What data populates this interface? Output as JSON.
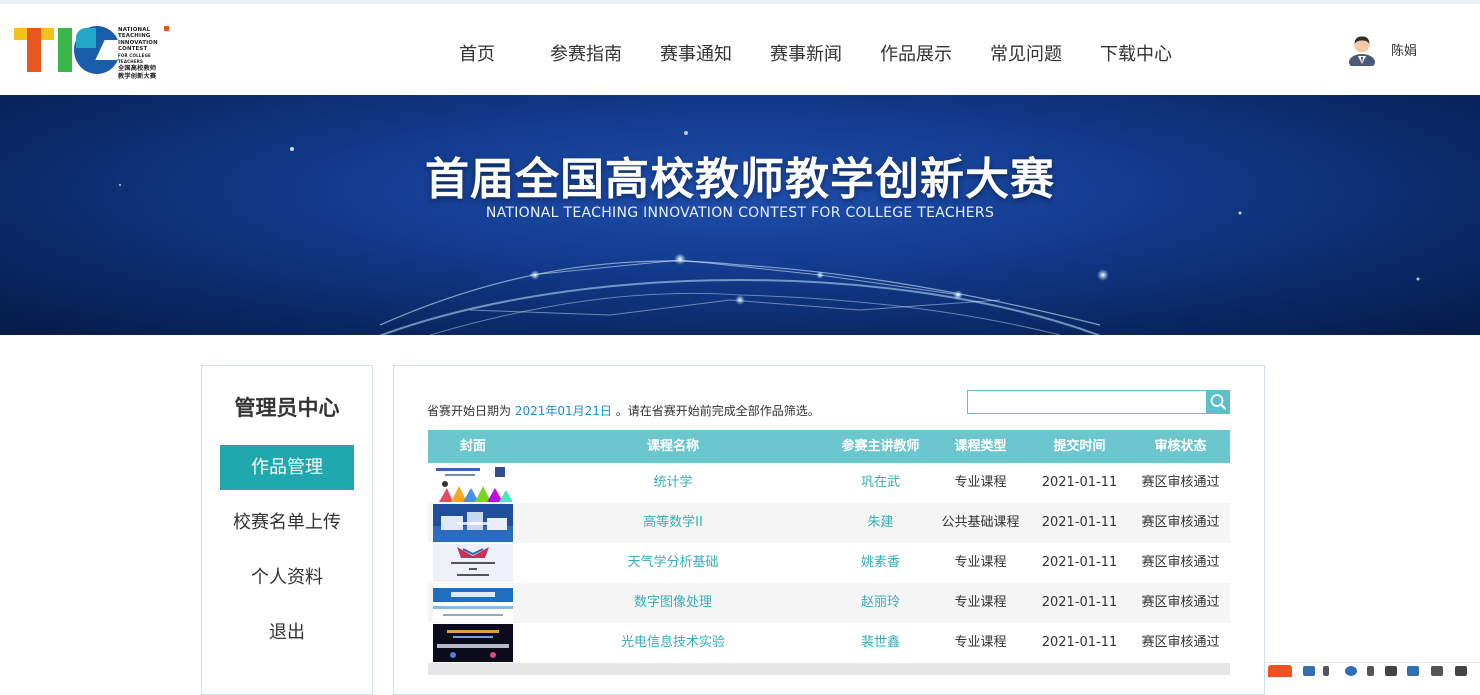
{
  "brand": {
    "logo_letters": "TIC",
    "logo_text_en": [
      "NATIONAL",
      "TEACHING",
      "INNOVATION",
      "CONTEST",
      "FOR COLLEGE TEACHERS"
    ],
    "logo_text_cn": [
      "全国高校教师",
      "教学创新大赛"
    ],
    "colors": {
      "yellow": "#f5c21b",
      "orange": "#e8551f",
      "green": "#3ab54a",
      "blue": "#1a5da8",
      "teal": "#23a7c9"
    }
  },
  "nav": {
    "items": [
      {
        "label": "首页"
      },
      {
        "label": "参赛指南"
      },
      {
        "label": "赛事通知"
      },
      {
        "label": "赛事新闻"
      },
      {
        "label": "作品展示"
      },
      {
        "label": "常见问题"
      },
      {
        "label": "下载中心"
      }
    ]
  },
  "user": {
    "name": "陈娟",
    "icon": "user-avatar-icon"
  },
  "banner": {
    "title": "首届全国高校教师教学创新大赛",
    "subtitle": "NATIONAL TEACHING INNOVATION CONTEST FOR COLLEGE TEACHERS"
  },
  "sidebar": {
    "title": "管理员中心",
    "items": [
      {
        "label": "作品管理",
        "active": true
      },
      {
        "label": "校赛名单上传",
        "active": false
      },
      {
        "label": "个人资料",
        "active": false
      },
      {
        "label": "退出",
        "active": false
      }
    ]
  },
  "main": {
    "notice_prefix": "省赛开始日期为",
    "notice_date": "2021年01月21日",
    "notice_suffix": "。请在省赛开始前完成全部作品筛选。",
    "search": {
      "value": "",
      "placeholder": "",
      "icon": "search-icon"
    },
    "table": {
      "headers": [
        "封面",
        "课程名称",
        "参赛主讲教师",
        "课程类型",
        "提交时间",
        "审核状态"
      ],
      "rows": [
        {
          "course": "统计学",
          "teacher": "巩在武",
          "type": "专业课程",
          "date": "2021-01-11",
          "status": "赛区审核通过"
        },
        {
          "course": "高等数学II",
          "teacher": "朱建",
          "type": "公共基础课程",
          "date": "2021-01-11",
          "status": "赛区审核通过"
        },
        {
          "course": "天气学分析基础",
          "teacher": "姚素香",
          "type": "专业课程",
          "date": "2021-01-11",
          "status": "赛区审核通过"
        },
        {
          "course": "数字图像处理",
          "teacher": "赵丽玲",
          "type": "专业课程",
          "date": "2021-01-11",
          "status": "赛区审核通过"
        },
        {
          "course": "光电信息技术实验",
          "teacher": "裴世鑫",
          "type": "专业课程",
          "date": "2021-01-11",
          "status": "赛区审核通过"
        }
      ]
    },
    "colors": {
      "accent": "#1fa8ae",
      "header_bg": "#6cc6ce",
      "link": "#35aeb7",
      "date": "#1a8fd0"
    }
  }
}
